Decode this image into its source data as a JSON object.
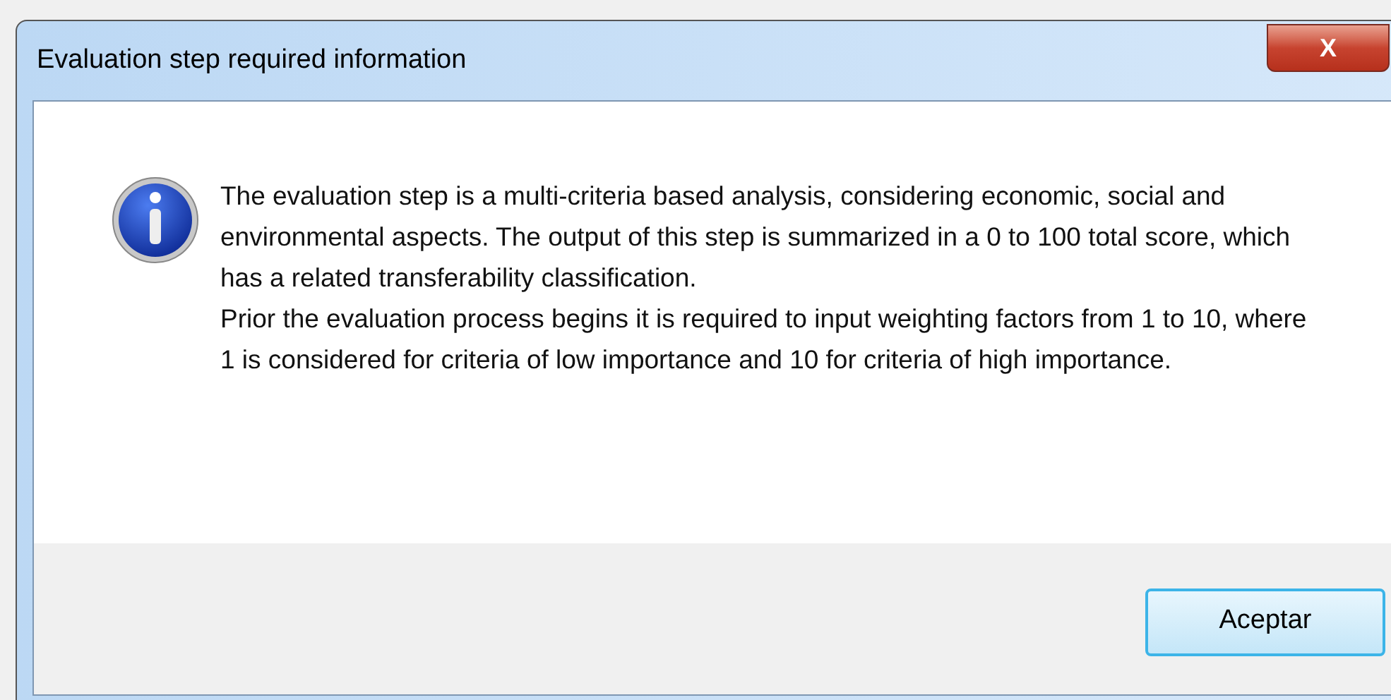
{
  "window": {
    "title": "Evaluation step required information",
    "close_label": "X"
  },
  "message": {
    "paragraphs": [
      "The evaluation step is a multi-criteria based analysis, considering economic, social and environmental aspects. The output of this step is summarized in a 0 to 100 total score, which has a related transferability classification.",
      "Prior the evaluation process begins it is required to input weighting factors from 1 to 10, where 1 is considered for criteria of low importance and 10 for criteria of high importance."
    ]
  },
  "buttons": [
    {
      "label": "Aceptar",
      "selected": true
    }
  ]
}
